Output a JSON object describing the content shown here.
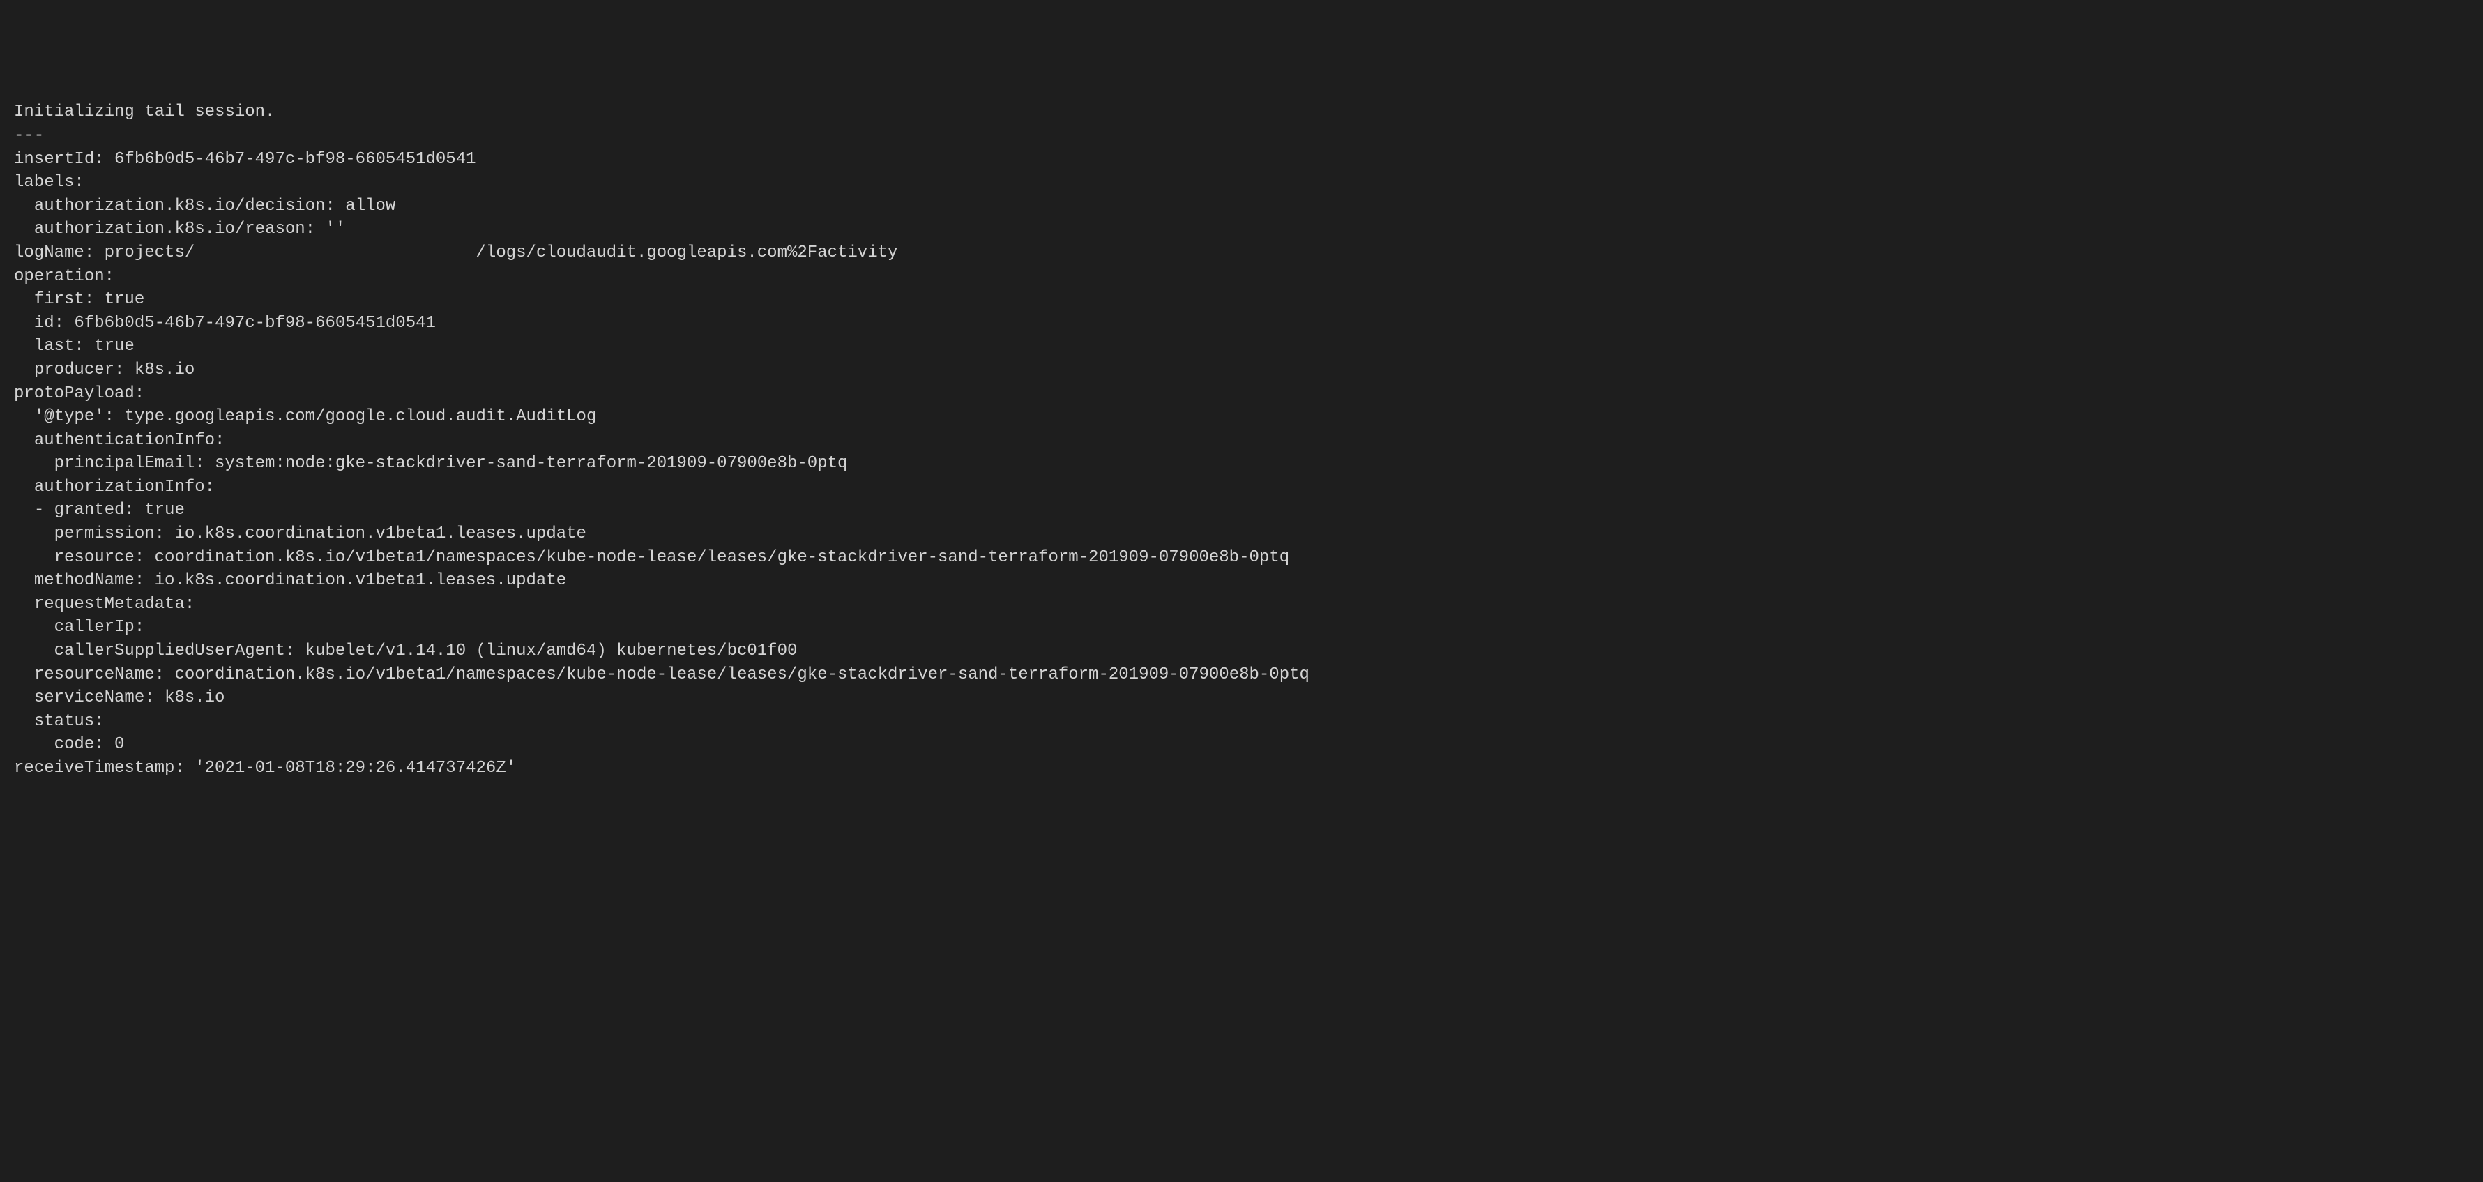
{
  "terminal": {
    "lines": [
      "Initializing tail session.",
      "---",
      "insertId: 6fb6b0d5-46b7-497c-bf98-6605451d0541",
      "labels:",
      "  authorization.k8s.io/decision: allow",
      "  authorization.k8s.io/reason: ''",
      "logName: projects/                            /logs/cloudaudit.googleapis.com%2Factivity",
      "operation:",
      "  first: true",
      "  id: 6fb6b0d5-46b7-497c-bf98-6605451d0541",
      "  last: true",
      "  producer: k8s.io",
      "protoPayload:",
      "  '@type': type.googleapis.com/google.cloud.audit.AuditLog",
      "  authenticationInfo:",
      "    principalEmail: system:node:gke-stackdriver-sand-terraform-201909-07900e8b-0ptq",
      "  authorizationInfo:",
      "  - granted: true",
      "    permission: io.k8s.coordination.v1beta1.leases.update",
      "    resource: coordination.k8s.io/v1beta1/namespaces/kube-node-lease/leases/gke-stackdriver-sand-terraform-201909-07900e8b-0ptq",
      "  methodName: io.k8s.coordination.v1beta1.leases.update",
      "  requestMetadata:",
      "    callerIp:",
      "    callerSuppliedUserAgent: kubelet/v1.14.10 (linux/amd64) kubernetes/bc01f00",
      "  resourceName: coordination.k8s.io/v1beta1/namespaces/kube-node-lease/leases/gke-stackdriver-sand-terraform-201909-07900e8b-0ptq",
      "  serviceName: k8s.io",
      "  status:",
      "    code: 0",
      "receiveTimestamp: '2021-01-08T18:29:26.414737426Z'"
    ]
  }
}
